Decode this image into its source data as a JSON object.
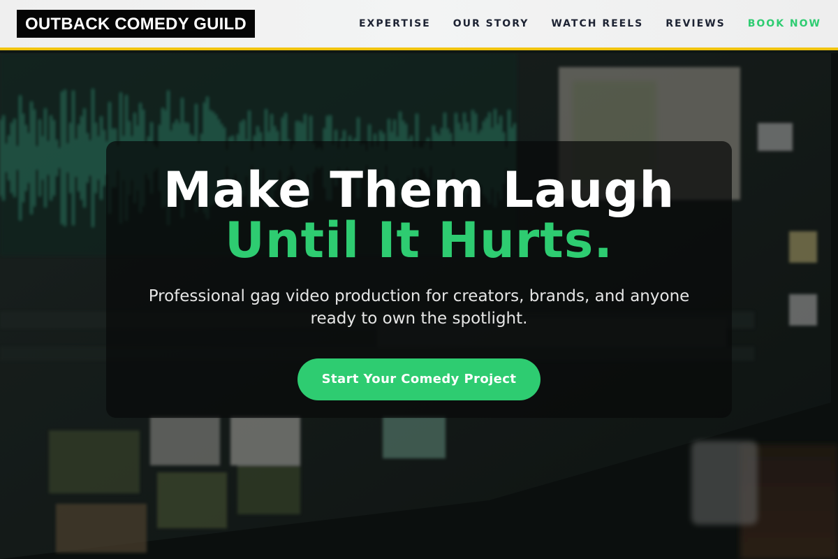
{
  "header": {
    "logo_text": "OUTBACK COMEDY GUILD",
    "accent_border_color": "#f1c40f",
    "nav": [
      {
        "label": "EXPERTISE"
      },
      {
        "label": "OUR STORY"
      },
      {
        "label": "WATCH REELS"
      },
      {
        "label": "REVIEWS"
      },
      {
        "label": "BOOK NOW",
        "accent": true
      }
    ]
  },
  "hero": {
    "headline_line1": "Make Them Laugh",
    "headline_line2": "Until It Hurts.",
    "subtitle": "Professional gag video production for creators, brands, and anyone ready to own the spotlight.",
    "cta_label": "Start Your Comedy Project",
    "background_image": "video-editing-monitor-photo"
  },
  "colors": {
    "brand_green": "#2ecc71",
    "nav_text": "#1d2333",
    "accent_yellow": "#f1c40f"
  }
}
